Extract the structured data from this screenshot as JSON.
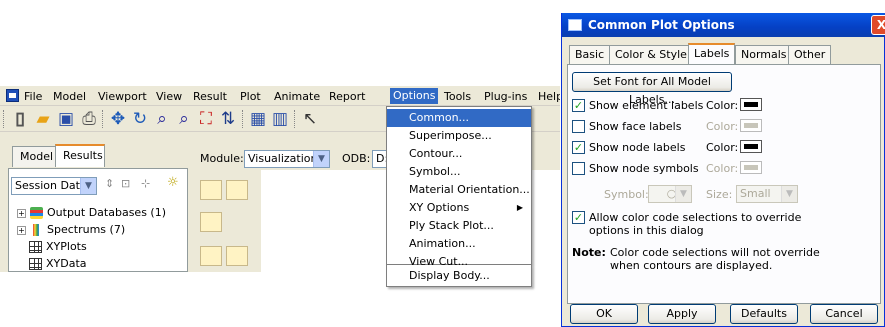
{
  "menubar": {
    "items": [
      "File",
      "Model",
      "Viewport",
      "View",
      "Result",
      "Plot",
      "Animate",
      "Report",
      "Options",
      "Tools",
      "Plug-ins",
      "Help"
    ]
  },
  "tabs": {
    "model": "Model",
    "results": "Results"
  },
  "module": {
    "label": "Module:",
    "value": "Visualization",
    "odb_label": "ODB:",
    "odb_value": "D:,"
  },
  "session": {
    "value": "Session Data"
  },
  "tree": {
    "items": [
      "Output Databases (1)",
      "Spectrums (7)",
      "XYPlots",
      "XYData"
    ]
  },
  "options_menu": {
    "items": [
      "Common...",
      "Superimpose...",
      "Contour...",
      "Symbol...",
      "Material Orientation...",
      "XY Options",
      "Ply Stack Plot...",
      "Animation...",
      "View Cut...",
      "Display Body..."
    ],
    "highlighted": "Common..."
  },
  "dialog": {
    "title": "Common Plot Options",
    "close": "X",
    "tabs": [
      "Basic",
      "Color & Style",
      "Labels",
      "Normals",
      "Other"
    ],
    "selected_tab": "Labels",
    "set_font_button": "Set Font for All Model Labels...",
    "color_label": "Color:",
    "options": [
      {
        "label": "Show element labels",
        "checked": true
      },
      {
        "label": "Show face labels",
        "checked": false
      },
      {
        "label": "Show node labels",
        "checked": true
      },
      {
        "label": "Show node symbols",
        "checked": false
      }
    ],
    "symbol_label": "Symbol:",
    "symbol_value": "○",
    "size_label": "Size:",
    "size_value": "Small",
    "allow_override_line1": "Allow color code selections to override",
    "allow_override_line2": "options in this dialog",
    "note_label": "Note:",
    "note_line1": "Color code selections will not override",
    "note_line2": "when contours are displayed.",
    "buttons": {
      "ok": "OK",
      "apply": "Apply",
      "defaults": "Defaults",
      "cancel": "Cancel"
    }
  }
}
